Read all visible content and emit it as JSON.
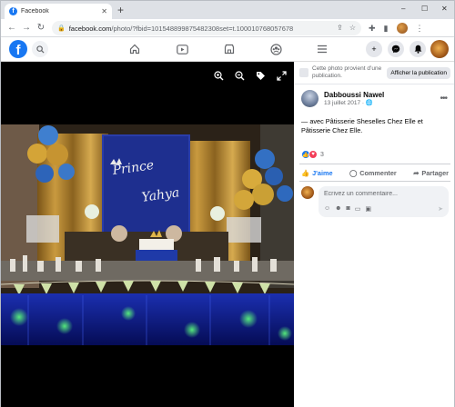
{
  "browser": {
    "tab_title": "Facebook",
    "tab_close": "✕",
    "new_tab": "+",
    "url_host": "facebook.com",
    "url_path": "/photo/?fbid=101548899875482308set=t.100010768057678",
    "win_min": "–",
    "win_max": "☐",
    "win_close": "✕"
  },
  "facebook": {
    "logo": "f"
  },
  "photo_content": {
    "banner_line1": "Prince",
    "banner_line2": "Yahya"
  },
  "panel": {
    "notice_text": "Cette photo provient d’une publication.",
    "notice_button": "Afficher la publication",
    "author_name": "Dabboussi Nawel",
    "post_date": "13 juillet 2017",
    "caption": "— avec Pâtisserie Sheselles Chez Elle et Pâtisserie Chez Elle.",
    "reaction_count": "3",
    "like_label": "J'aime",
    "comment_label": "Commenter",
    "share_label": "Partager",
    "comment_placeholder": "Écrivez un commentaire..."
  },
  "colors": {
    "facebook_blue": "#1877f2",
    "love_red": "#f33e58"
  },
  "icons": [
    "back-arrow-icon",
    "forward-arrow-icon",
    "reload-icon",
    "lock-icon",
    "share-icon",
    "star-icon",
    "puzzle-icon",
    "sidepanel-icon",
    "search-icon",
    "home-icon",
    "watch-icon",
    "marketplace-icon",
    "groups-icon",
    "menu-icon",
    "plus-icon",
    "messenger-icon",
    "bell-icon",
    "zoom-in-icon",
    "zoom-out-icon",
    "tag-icon",
    "fullscreen-icon",
    "globe-icon",
    "more-icon",
    "like-icon",
    "comment-icon",
    "share-arrow-icon",
    "emoji-icon",
    "camera-icon",
    "gif-icon",
    "sticker-icon",
    "send-icon"
  ]
}
